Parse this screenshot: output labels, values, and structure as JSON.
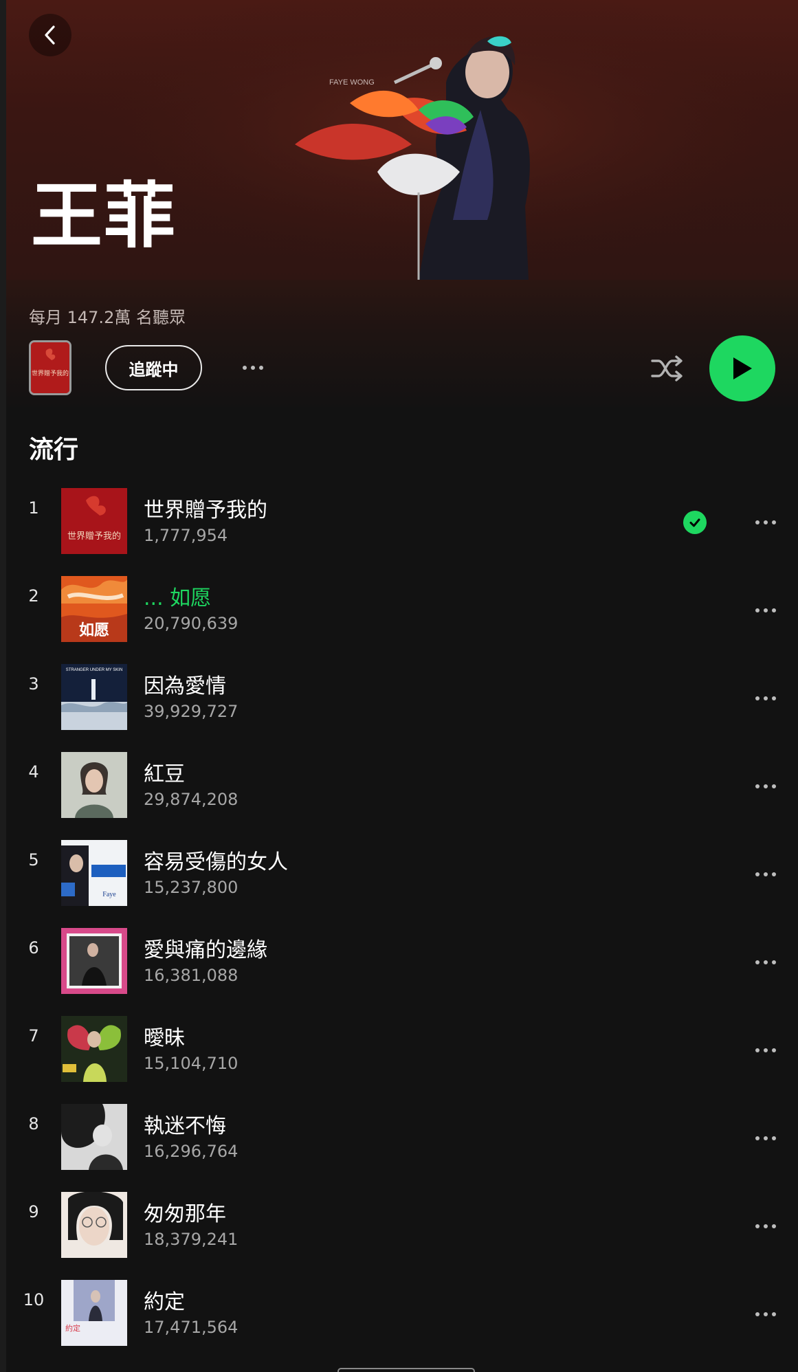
{
  "header": {
    "artist_name": "王菲",
    "album_art_caption": "FAYE WONG",
    "monthly_listeners": "每月 147.2萬 名聽眾"
  },
  "actions": {
    "follow_label": "追蹤中",
    "thumbnail_text": "世界贈予我的"
  },
  "popular": {
    "title": "流行",
    "tracks": [
      {
        "rank": "1",
        "title": "世界贈予我的",
        "plays": "1,777,954",
        "saved": true,
        "playing": false
      },
      {
        "rank": "2",
        "title": "... 如愿",
        "plays": "20,790,639",
        "saved": false,
        "playing": true
      },
      {
        "rank": "3",
        "title": "因為愛情",
        "plays": "39,929,727",
        "saved": false,
        "playing": false
      },
      {
        "rank": "4",
        "title": "紅豆",
        "plays": "29,874,208",
        "saved": false,
        "playing": false
      },
      {
        "rank": "5",
        "title": "容易受傷的女人",
        "plays": "15,237,800",
        "saved": false,
        "playing": false
      },
      {
        "rank": "6",
        "title": "愛與痛的邊緣",
        "plays": "16,381,088",
        "saved": false,
        "playing": false
      },
      {
        "rank": "7",
        "title": "曖昧",
        "plays": "15,104,710",
        "saved": false,
        "playing": false
      },
      {
        "rank": "8",
        "title": "執迷不悔",
        "plays": "16,296,764",
        "saved": false,
        "playing": false
      },
      {
        "rank": "9",
        "title": "匆匆那年",
        "plays": "18,379,241",
        "saved": false,
        "playing": false
      },
      {
        "rank": "10",
        "title": "約定",
        "plays": "17,471,564",
        "saved": false,
        "playing": false
      }
    ]
  },
  "colors": {
    "accent": "#1ed760",
    "background": "#121212",
    "header_tint": "#4a1a14"
  },
  "icons": {
    "back": "chevron-left-icon",
    "more": "more-horizontal-icon",
    "shuffle": "shuffle-icon",
    "play": "play-icon",
    "saved": "check-circle-icon"
  }
}
